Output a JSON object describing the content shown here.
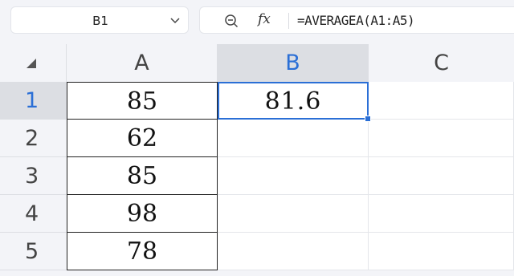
{
  "formula_bar": {
    "name_box": "B1",
    "formula": "=AVERAGEA(A1:A5)",
    "fx_label": "fx"
  },
  "columns": [
    "A",
    "B",
    "C"
  ],
  "rows": [
    "1",
    "2",
    "3",
    "4",
    "5"
  ],
  "cells": {
    "A1": "85",
    "A2": "62",
    "A3": "85",
    "A4": "98",
    "A5": "78",
    "B1": "81.6"
  },
  "selected_cell": "B1",
  "colors": {
    "accent": "#2b6fd6",
    "header_bg": "#f3f4f8",
    "active_header_bg": "#dcdee3"
  },
  "icons": [
    "zoom-icon",
    "fx-icon",
    "chevron-down-icon",
    "select-all-triangle-icon"
  ]
}
